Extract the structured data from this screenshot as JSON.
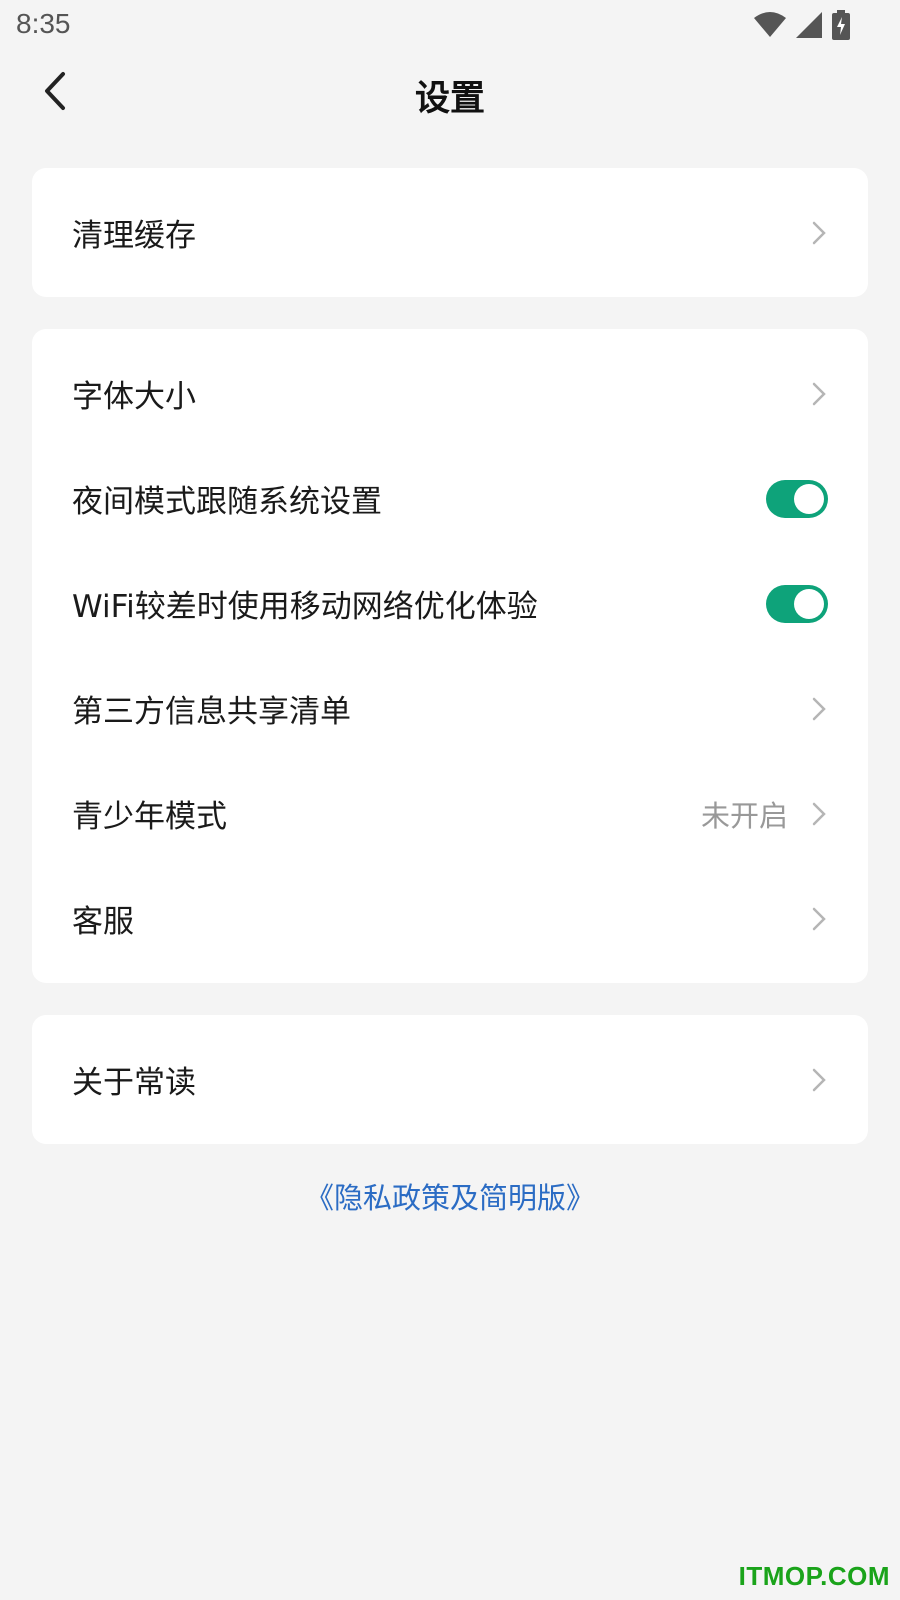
{
  "status_bar": {
    "time": "8:35",
    "icons": [
      "wifi-icon",
      "signal-icon",
      "battery-charging-icon"
    ]
  },
  "header": {
    "title": "设置",
    "back_icon": "back-arrow-icon"
  },
  "sections": [
    {
      "items": [
        {
          "label": "清理缓存",
          "control": "chevron"
        }
      ]
    },
    {
      "items": [
        {
          "label": "字体大小",
          "control": "chevron"
        },
        {
          "label": "夜间模式跟随系统设置",
          "control": "toggle",
          "on": true
        },
        {
          "label": "WiFi较差时使用移动网络优化体验",
          "control": "toggle",
          "on": true
        },
        {
          "label": "第三方信息共享清单",
          "control": "chevron"
        },
        {
          "label": "青少年模式",
          "value": "未开启",
          "control": "chevron"
        },
        {
          "label": "客服",
          "control": "chevron"
        }
      ]
    },
    {
      "items": [
        {
          "label": "关于常读",
          "control": "chevron"
        }
      ]
    }
  ],
  "privacy_link": "《隐私政策及简明版》",
  "watermark": "ITMOP.COM",
  "colors": {
    "background": "#f4f4f4",
    "toggle_on": "#0ea37a",
    "link": "#2b6cc4",
    "watermark": "#1aa31a"
  }
}
